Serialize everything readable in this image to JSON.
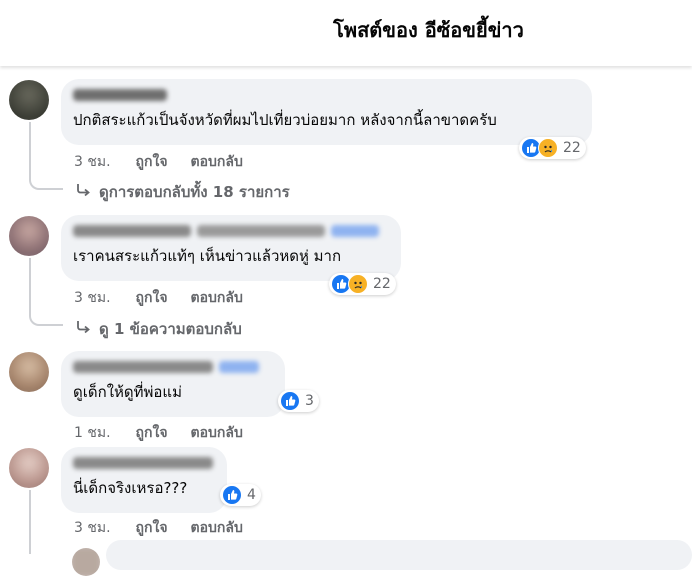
{
  "header": {
    "title": "โพสต์ของ อีซ้อขยี้ข่าว"
  },
  "comments": [
    {
      "text": "ปกติสระแก้วเป็นจังหวัดที่ผมไปเที่ยวบ่อยมาก หลังจากนี้ลาขาดครับ",
      "time": "3 ชม.",
      "like_label": "ถูกใจ",
      "reply_label": "ตอบกลับ",
      "reaction_count": "22",
      "reactions": [
        "like",
        "sad"
      ],
      "view_replies": "ดูการตอบกลับทั้ง 18 รายการ"
    },
    {
      "text": "เราคนสระแก้วแท้ๆ เห็นข่าวแล้วหดหู่ มาก",
      "time": "3 ชม.",
      "like_label": "ถูกใจ",
      "reply_label": "ตอบกลับ",
      "reaction_count": "22",
      "reactions": [
        "like",
        "sad"
      ],
      "view_replies": "ดู 1 ข้อความตอบกลับ"
    },
    {
      "text": "ดูเด็กให้ดูที่พ่อแม่",
      "time": "1 ชม.",
      "like_label": "ถูกใจ",
      "reply_label": "ตอบกลับ",
      "reaction_count": "3",
      "reactions": [
        "like"
      ]
    },
    {
      "text": "นี่เด็กจริงเหรอ???",
      "time": "3 ชม.",
      "like_label": "ถูกใจ",
      "reply_label": "ตอบกลับ",
      "reaction_count": "4",
      "reactions": [
        "like"
      ]
    }
  ],
  "colors": {
    "like": "#1877f2",
    "sad": "#f7b125",
    "bubble": "#f0f2f5",
    "meta": "#65676b"
  },
  "icons": {
    "like": "thumbs-up-icon",
    "sad": "sad-face-icon",
    "reply_arrow": "reply-arrow-icon"
  }
}
